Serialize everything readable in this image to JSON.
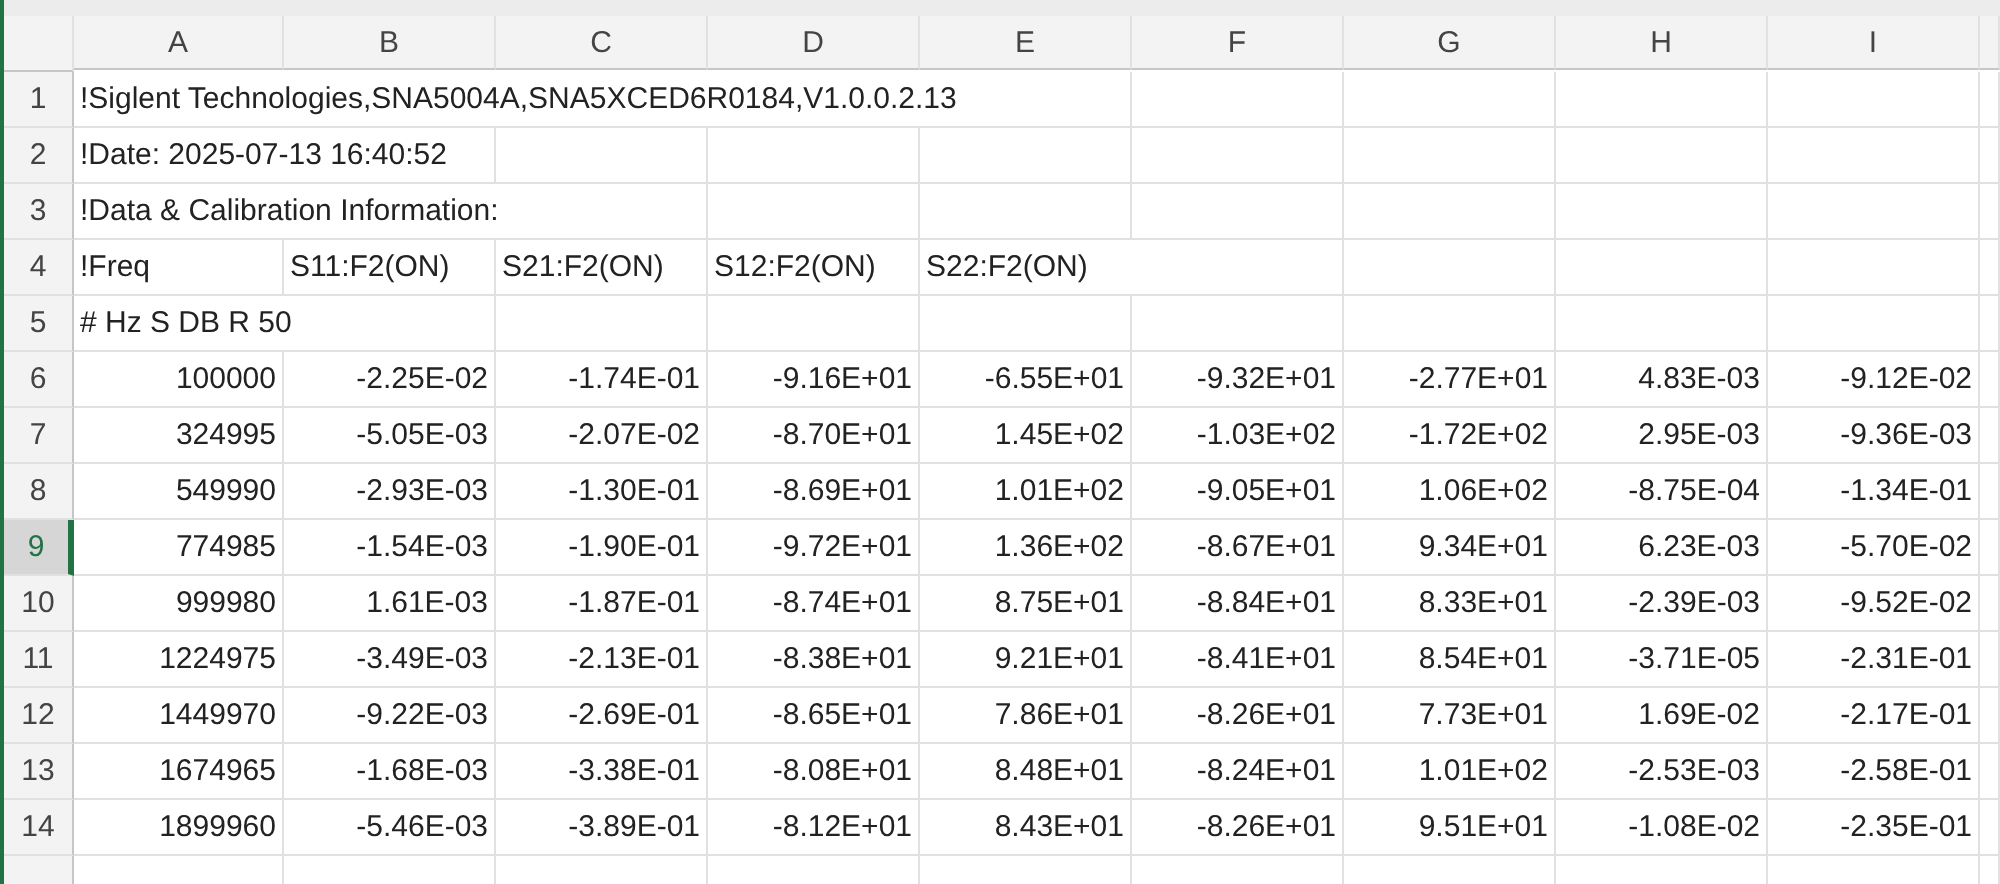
{
  "columns": [
    "A",
    "B",
    "C",
    "D",
    "E",
    "F",
    "G",
    "H",
    "I"
  ],
  "rows": [
    {
      "number": "1",
      "kind": "text",
      "selected": false,
      "cells": [
        "!Siglent Technologies,SNA5004A,SNA5XCED6R0184,V1.0.0.2.13"
      ]
    },
    {
      "number": "2",
      "kind": "text",
      "selected": false,
      "cells": [
        "!Date: 2025-07-13 16:40:52"
      ]
    },
    {
      "number": "3",
      "kind": "text",
      "selected": false,
      "cells": [
        "!Data & Calibration Information:"
      ]
    },
    {
      "number": "4",
      "kind": "text",
      "selected": false,
      "cells": [
        "!Freq",
        "S11:F2(ON)",
        "S21:F2(ON)",
        "S12:F2(ON)",
        "S22:F2(ON)"
      ]
    },
    {
      "number": "5",
      "kind": "text",
      "selected": false,
      "cells": [
        "# Hz S DB R 50"
      ]
    },
    {
      "number": "6",
      "kind": "number",
      "selected": false,
      "cells": [
        "100000",
        "-2.25E-02",
        "-1.74E-01",
        "-9.16E+01",
        "-6.55E+01",
        "-9.32E+01",
        "-2.77E+01",
        "4.83E-03",
        "-9.12E-02"
      ]
    },
    {
      "number": "7",
      "kind": "number",
      "selected": false,
      "cells": [
        "324995",
        "-5.05E-03",
        "-2.07E-02",
        "-8.70E+01",
        "1.45E+02",
        "-1.03E+02",
        "-1.72E+02",
        "2.95E-03",
        "-9.36E-03"
      ]
    },
    {
      "number": "8",
      "kind": "number",
      "selected": false,
      "cells": [
        "549990",
        "-2.93E-03",
        "-1.30E-01",
        "-8.69E+01",
        "1.01E+02",
        "-9.05E+01",
        "1.06E+02",
        "-8.75E-04",
        "-1.34E-01"
      ]
    },
    {
      "number": "9",
      "kind": "number",
      "selected": true,
      "cells": [
        "774985",
        "-1.54E-03",
        "-1.90E-01",
        "-9.72E+01",
        "1.36E+02",
        "-8.67E+01",
        "9.34E+01",
        "6.23E-03",
        "-5.70E-02"
      ]
    },
    {
      "number": "10",
      "kind": "number",
      "selected": false,
      "cells": [
        "999980",
        "1.61E-03",
        "-1.87E-01",
        "-8.74E+01",
        "8.75E+01",
        "-8.84E+01",
        "8.33E+01",
        "-2.39E-03",
        "-9.52E-02"
      ]
    },
    {
      "number": "11",
      "kind": "number",
      "selected": false,
      "cells": [
        "1224975",
        "-3.49E-03",
        "-2.13E-01",
        "-8.38E+01",
        "9.21E+01",
        "-8.41E+01",
        "8.54E+01",
        "-3.71E-05",
        "-2.31E-01"
      ]
    },
    {
      "number": "12",
      "kind": "number",
      "selected": false,
      "cells": [
        "1449970",
        "-9.22E-03",
        "-2.69E-01",
        "-8.65E+01",
        "7.86E+01",
        "-8.26E+01",
        "7.73E+01",
        "1.69E-02",
        "-2.17E-01"
      ]
    },
    {
      "number": "13",
      "kind": "number",
      "selected": false,
      "cells": [
        "1674965",
        "-1.68E-03",
        "-3.38E-01",
        "-8.08E+01",
        "8.48E+01",
        "-8.24E+01",
        "1.01E+02",
        "-2.53E-03",
        "-2.58E-01"
      ]
    },
    {
      "number": "14",
      "kind": "number",
      "selected": false,
      "cells": [
        "1899960",
        "-5.46E-03",
        "-3.89E-01",
        "-8.12E+01",
        "8.43E+01",
        "-8.26E+01",
        "9.51E+01",
        "-1.08E-02",
        "-2.35E-01"
      ]
    }
  ]
}
